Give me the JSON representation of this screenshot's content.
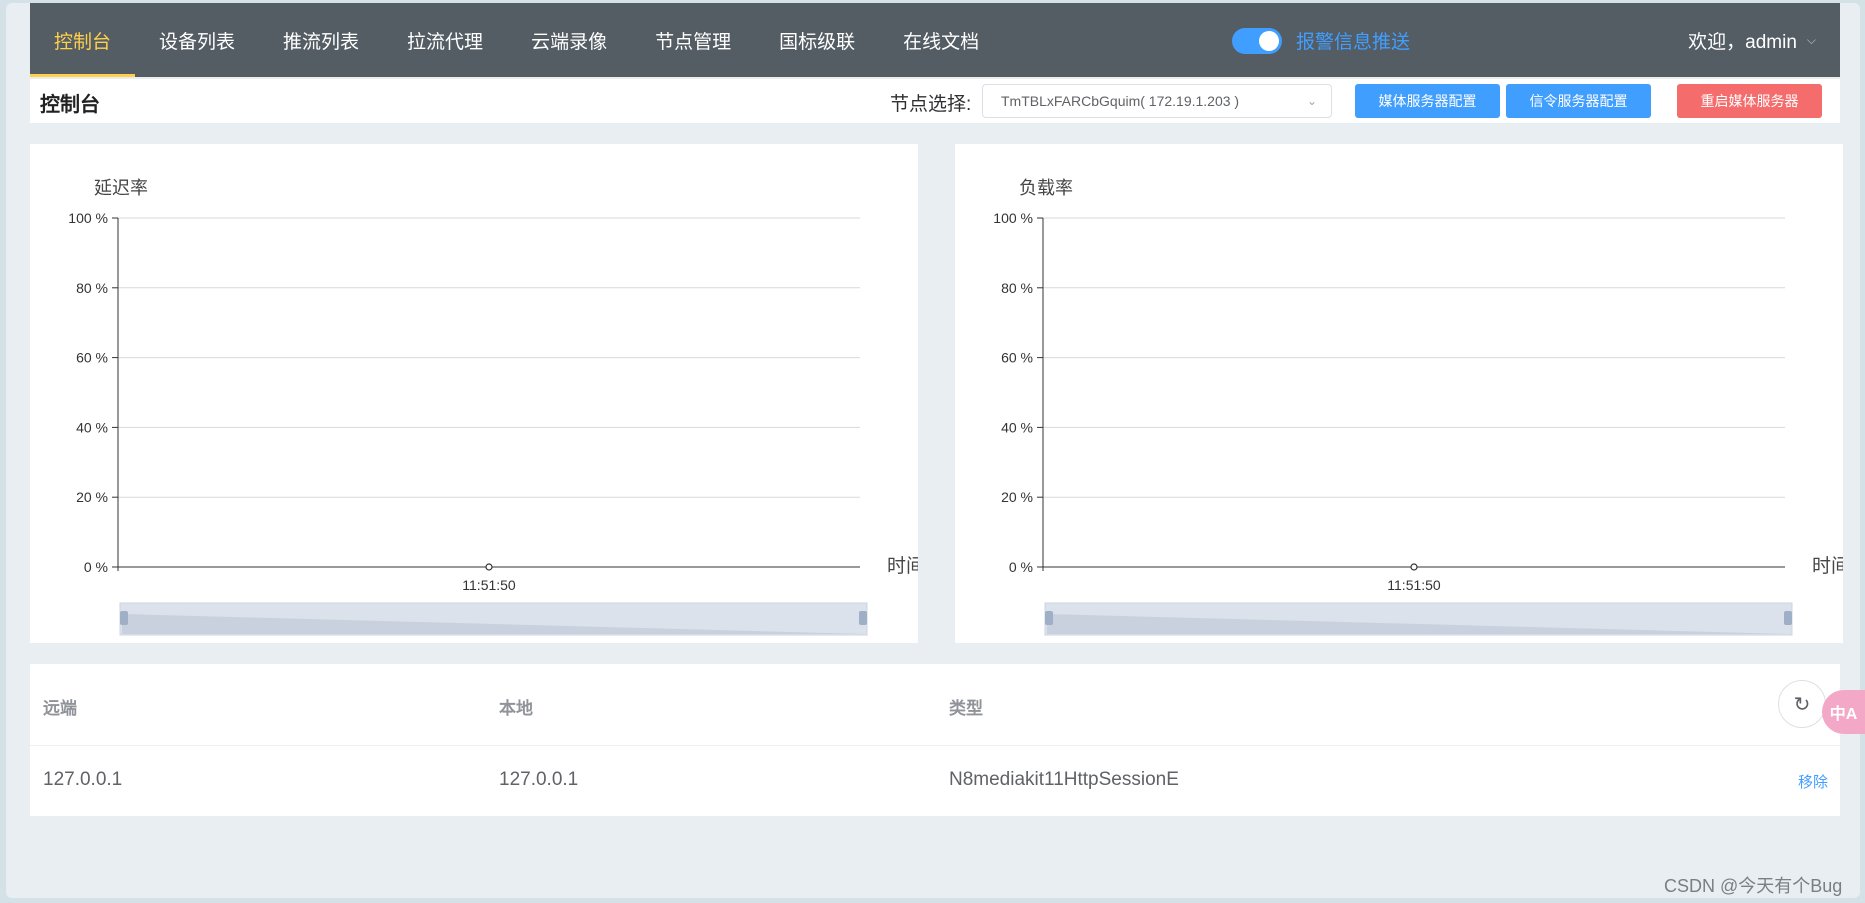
{
  "nav": {
    "items": [
      "控制台",
      "设备列表",
      "推流列表",
      "拉流代理",
      "云端录像",
      "节点管理",
      "国标级联",
      "在线文档"
    ],
    "active_index": 0,
    "alarm_label": "报警信息推送",
    "alarm_on": true,
    "welcome": "欢迎，admin"
  },
  "toolbar": {
    "title": "控制台",
    "node_label": "节点选择:",
    "node_value": "TmTBLxFARCbGquim( 172.19.1.203 )",
    "btn_media": "媒体服务器配置",
    "btn_signal": "信令服务器配置",
    "btn_restart": "重启媒体服务器"
  },
  "chart_data": [
    {
      "type": "line",
      "title": "延迟率",
      "xlabel": "时间",
      "x": [
        "11:51:50"
      ],
      "y_ticks": [
        "0 %",
        "20 %",
        "40 %",
        "60 %",
        "80 %",
        "100 %"
      ],
      "ylim": [
        0,
        100
      ],
      "series": [
        {
          "values": [
            0
          ]
        }
      ],
      "grid": true,
      "dataZoom": true
    },
    {
      "type": "line",
      "title": "负载率",
      "xlabel": "时间",
      "x": [
        "11:51:50"
      ],
      "y_ticks": [
        "0 %",
        "20 %",
        "40 %",
        "60 %",
        "80 %",
        "100 %"
      ],
      "ylim": [
        0,
        100
      ],
      "series": [
        {
          "values": [
            0
          ]
        }
      ],
      "grid": true,
      "dataZoom": true
    }
  ],
  "table": {
    "headers": [
      "远端",
      "本地",
      "类型"
    ],
    "rows": [
      {
        "remote": "127.0.0.1",
        "local": "127.0.0.1",
        "type": "N8mediakit11HttpSessionE",
        "action": "移除"
      }
    ]
  },
  "fab": {
    "translate_label": "中A"
  },
  "watermark": "CSDN @今天有个Bug",
  "colors": {
    "nav_bg": "#545c64",
    "active": "#ffd04b",
    "primary": "#409eff",
    "danger": "#f56c6c"
  }
}
